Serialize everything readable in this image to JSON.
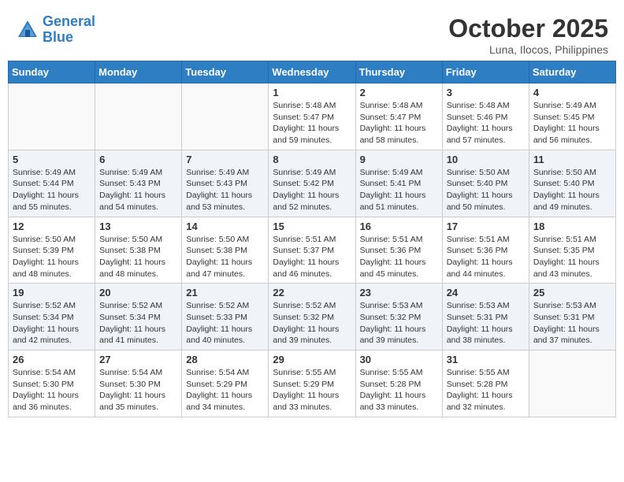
{
  "header": {
    "logo_line1": "General",
    "logo_line2": "Blue",
    "month": "October 2025",
    "location": "Luna, Ilocos, Philippines"
  },
  "weekdays": [
    "Sunday",
    "Monday",
    "Tuesday",
    "Wednesday",
    "Thursday",
    "Friday",
    "Saturday"
  ],
  "weeks": [
    [
      {
        "day": "",
        "info": ""
      },
      {
        "day": "",
        "info": ""
      },
      {
        "day": "",
        "info": ""
      },
      {
        "day": "1",
        "info": "Sunrise: 5:48 AM\nSunset: 5:47 PM\nDaylight: 11 hours\nand 59 minutes."
      },
      {
        "day": "2",
        "info": "Sunrise: 5:48 AM\nSunset: 5:47 PM\nDaylight: 11 hours\nand 58 minutes."
      },
      {
        "day": "3",
        "info": "Sunrise: 5:48 AM\nSunset: 5:46 PM\nDaylight: 11 hours\nand 57 minutes."
      },
      {
        "day": "4",
        "info": "Sunrise: 5:49 AM\nSunset: 5:45 PM\nDaylight: 11 hours\nand 56 minutes."
      }
    ],
    [
      {
        "day": "5",
        "info": "Sunrise: 5:49 AM\nSunset: 5:44 PM\nDaylight: 11 hours\nand 55 minutes."
      },
      {
        "day": "6",
        "info": "Sunrise: 5:49 AM\nSunset: 5:43 PM\nDaylight: 11 hours\nand 54 minutes."
      },
      {
        "day": "7",
        "info": "Sunrise: 5:49 AM\nSunset: 5:43 PM\nDaylight: 11 hours\nand 53 minutes."
      },
      {
        "day": "8",
        "info": "Sunrise: 5:49 AM\nSunset: 5:42 PM\nDaylight: 11 hours\nand 52 minutes."
      },
      {
        "day": "9",
        "info": "Sunrise: 5:49 AM\nSunset: 5:41 PM\nDaylight: 11 hours\nand 51 minutes."
      },
      {
        "day": "10",
        "info": "Sunrise: 5:50 AM\nSunset: 5:40 PM\nDaylight: 11 hours\nand 50 minutes."
      },
      {
        "day": "11",
        "info": "Sunrise: 5:50 AM\nSunset: 5:40 PM\nDaylight: 11 hours\nand 49 minutes."
      }
    ],
    [
      {
        "day": "12",
        "info": "Sunrise: 5:50 AM\nSunset: 5:39 PM\nDaylight: 11 hours\nand 48 minutes."
      },
      {
        "day": "13",
        "info": "Sunrise: 5:50 AM\nSunset: 5:38 PM\nDaylight: 11 hours\nand 48 minutes."
      },
      {
        "day": "14",
        "info": "Sunrise: 5:50 AM\nSunset: 5:38 PM\nDaylight: 11 hours\nand 47 minutes."
      },
      {
        "day": "15",
        "info": "Sunrise: 5:51 AM\nSunset: 5:37 PM\nDaylight: 11 hours\nand 46 minutes."
      },
      {
        "day": "16",
        "info": "Sunrise: 5:51 AM\nSunset: 5:36 PM\nDaylight: 11 hours\nand 45 minutes."
      },
      {
        "day": "17",
        "info": "Sunrise: 5:51 AM\nSunset: 5:36 PM\nDaylight: 11 hours\nand 44 minutes."
      },
      {
        "day": "18",
        "info": "Sunrise: 5:51 AM\nSunset: 5:35 PM\nDaylight: 11 hours\nand 43 minutes."
      }
    ],
    [
      {
        "day": "19",
        "info": "Sunrise: 5:52 AM\nSunset: 5:34 PM\nDaylight: 11 hours\nand 42 minutes."
      },
      {
        "day": "20",
        "info": "Sunrise: 5:52 AM\nSunset: 5:34 PM\nDaylight: 11 hours\nand 41 minutes."
      },
      {
        "day": "21",
        "info": "Sunrise: 5:52 AM\nSunset: 5:33 PM\nDaylight: 11 hours\nand 40 minutes."
      },
      {
        "day": "22",
        "info": "Sunrise: 5:52 AM\nSunset: 5:32 PM\nDaylight: 11 hours\nand 39 minutes."
      },
      {
        "day": "23",
        "info": "Sunrise: 5:53 AM\nSunset: 5:32 PM\nDaylight: 11 hours\nand 39 minutes."
      },
      {
        "day": "24",
        "info": "Sunrise: 5:53 AM\nSunset: 5:31 PM\nDaylight: 11 hours\nand 38 minutes."
      },
      {
        "day": "25",
        "info": "Sunrise: 5:53 AM\nSunset: 5:31 PM\nDaylight: 11 hours\nand 37 minutes."
      }
    ],
    [
      {
        "day": "26",
        "info": "Sunrise: 5:54 AM\nSunset: 5:30 PM\nDaylight: 11 hours\nand 36 minutes."
      },
      {
        "day": "27",
        "info": "Sunrise: 5:54 AM\nSunset: 5:30 PM\nDaylight: 11 hours\nand 35 minutes."
      },
      {
        "day": "28",
        "info": "Sunrise: 5:54 AM\nSunset: 5:29 PM\nDaylight: 11 hours\nand 34 minutes."
      },
      {
        "day": "29",
        "info": "Sunrise: 5:55 AM\nSunset: 5:29 PM\nDaylight: 11 hours\nand 33 minutes."
      },
      {
        "day": "30",
        "info": "Sunrise: 5:55 AM\nSunset: 5:28 PM\nDaylight: 11 hours\nand 33 minutes."
      },
      {
        "day": "31",
        "info": "Sunrise: 5:55 AM\nSunset: 5:28 PM\nDaylight: 11 hours\nand 32 minutes."
      },
      {
        "day": "",
        "info": ""
      }
    ]
  ]
}
